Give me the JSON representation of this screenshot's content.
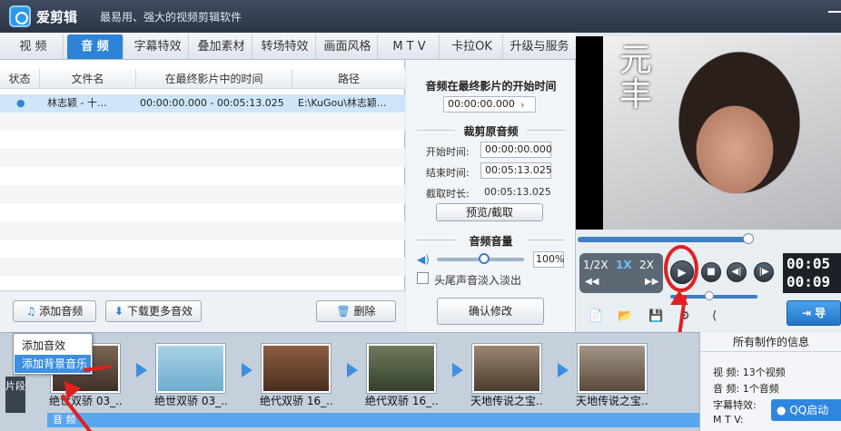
{
  "app": {
    "name": "爱剪辑",
    "slogan": "最易用、强大的视频剪辑软件"
  },
  "tabs": [
    "视  频",
    "音  频",
    "字幕特效",
    "叠加素材",
    "转场特效",
    "画面风格",
    "M T V",
    "卡拉OK",
    "升级与服务"
  ],
  "active_tab": "音  频",
  "file_list": {
    "columns": [
      "状态",
      "文件名",
      "在最终影片中的时间",
      "路径"
    ],
    "rows": [
      {
        "status": "●",
        "name": "林志颖 - 十...",
        "time": "00:00:00.000 - 00:05:13.025",
        "path": "E:\\KuGou\\林志颖..."
      }
    ]
  },
  "toolbar": {
    "add_audio": "添加音频",
    "download_more": "下载更多音效",
    "delete": "删除"
  },
  "popup": {
    "items": [
      "添加音效",
      "添加背景音乐"
    ],
    "highlighted": "添加背景音乐"
  },
  "settings": {
    "start_title": "音频在最终影片的开始时间",
    "start_value": "00:00:00.000",
    "trim_title": "裁剪原音频",
    "start_label": "开始时间:",
    "start_time": "00:00:00.000",
    "end_label": "结束时间:",
    "end_time": "00:05:13.025",
    "duration_label": "截取时长:",
    "duration": "00:05:13.025",
    "preview_button": "预览/截取",
    "volume_title": "音频音量",
    "volume_value": "100%",
    "fade_label": "头尾声音淡入淡出",
    "confirm_button": "确认修改"
  },
  "preview": {
    "overlay_text": "元丰",
    "speeds": [
      "1/2X",
      "1X",
      "2X"
    ],
    "active_speed": "1X",
    "time_a": "00:05",
    "time_b": "00:09",
    "export_label": "导"
  },
  "timeline": {
    "side_label": "片段",
    "clips": [
      "绝世双骄 03_...",
      "绝世双骄 03_...",
      "绝代双骄 16_...",
      "绝代双骄 16_...",
      "天地传说之宝...",
      "天地传说之宝..."
    ],
    "audio_track_label": "音 频"
  },
  "info": {
    "title": "所有制作的信息",
    "rows": [
      {
        "label": "视    频:",
        "value": "13个视频"
      },
      {
        "label": "音    频:",
        "value": "1个音频"
      },
      {
        "label": "字幕特效:",
        "value": ""
      },
      {
        "label": "M  T  V:",
        "value": ""
      }
    ],
    "qq_label": "QQ启动"
  },
  "colors": {
    "accent": "#2e83d6",
    "annotation": "#e02020",
    "titlebar": "#2c3646"
  }
}
